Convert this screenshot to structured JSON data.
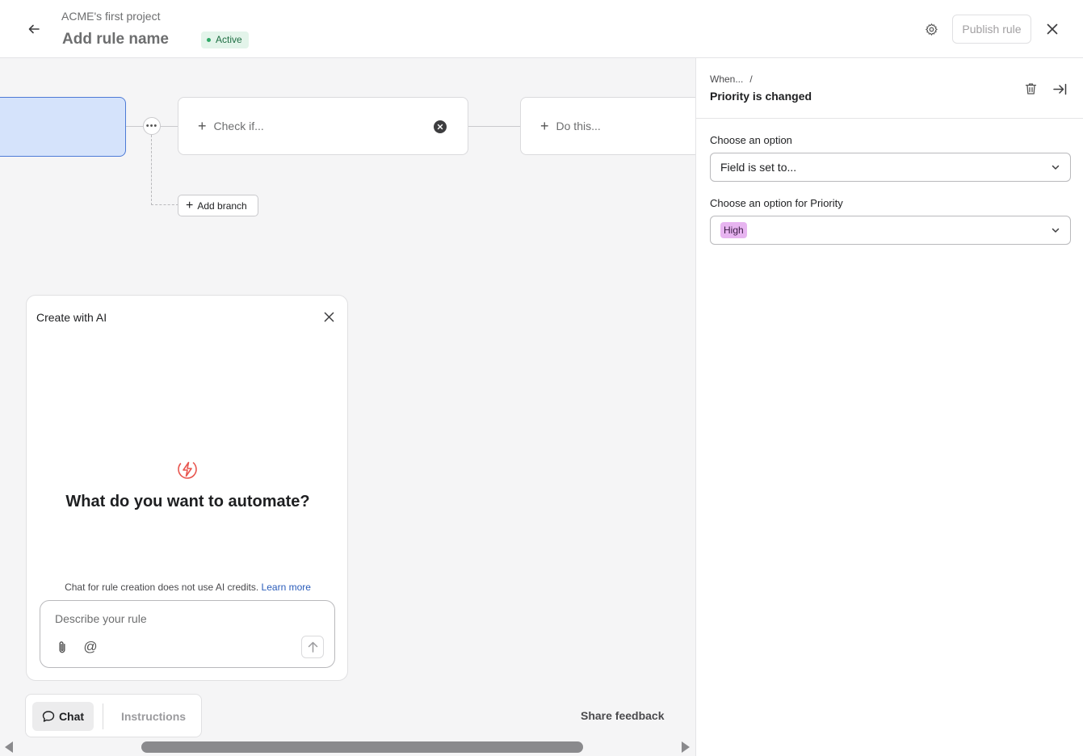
{
  "header": {
    "project_name": "ACME's first project",
    "rule_name": "Add rule name",
    "status": "Active",
    "publish_label": "Publish rule"
  },
  "canvas": {
    "check_node_label": "Check if...",
    "do_node_label": "Do this...",
    "add_branch_label": "Add branch"
  },
  "ai_panel": {
    "title": "Create with AI",
    "heading": "What do you want to automate?",
    "note": "Chat for rule creation does not use AI credits.",
    "learn_more": "Learn more",
    "input_placeholder": "Describe your rule"
  },
  "tabs": {
    "chat": "Chat",
    "instructions": "Instructions"
  },
  "share_feedback": "Share feedback",
  "right_panel": {
    "breadcrumb_parent": "When...",
    "breadcrumb_sep": "/",
    "title": "Priority is changed",
    "option_label": "Choose an option",
    "option_value": "Field is set to...",
    "priority_label": "Choose an option for Priority",
    "priority_value": "High"
  },
  "colors": {
    "status_green": "#2fa866",
    "trigger_fill": "#d5e3fb",
    "priority_tag": "#e7b4f0",
    "link_blue": "#2a5cba"
  }
}
